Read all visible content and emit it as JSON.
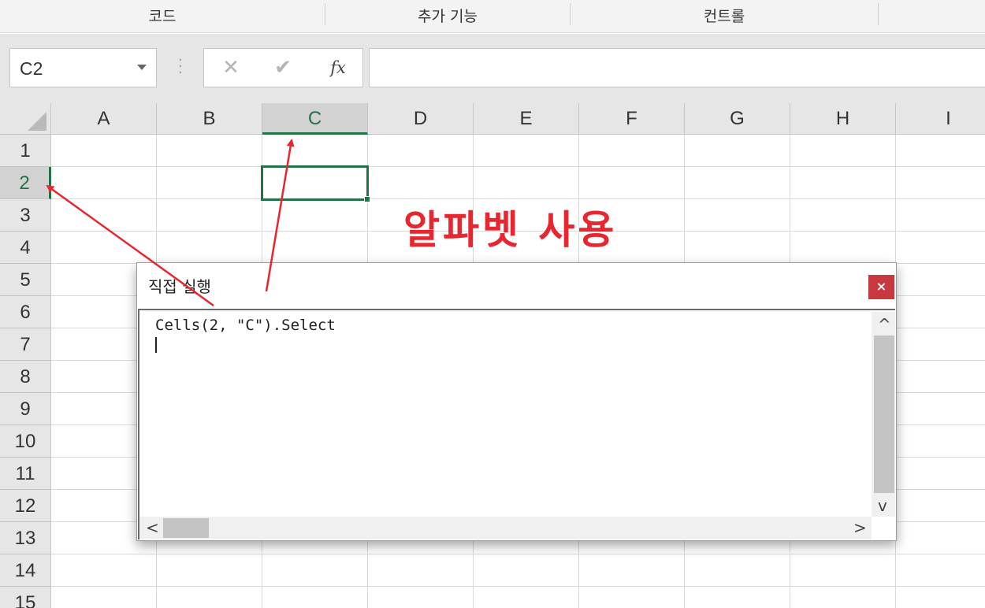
{
  "ribbon": {
    "groups": [
      "코드",
      "추가 기능",
      "컨트롤"
    ]
  },
  "formula_bar": {
    "name_box": "C2",
    "cancel_glyph": "✕",
    "enter_glyph": "✔",
    "fx_label": "fx",
    "formula": ""
  },
  "sheet": {
    "columns": [
      "A",
      "B",
      "C",
      "D",
      "E",
      "F",
      "G",
      "H",
      "I"
    ],
    "rows": [
      "1",
      "2",
      "3",
      "4",
      "5",
      "6",
      "7",
      "8",
      "9",
      "10",
      "11",
      "12",
      "13",
      "14",
      "15"
    ],
    "selected_column": "C",
    "selected_row": "2"
  },
  "annotation": {
    "text": "알파벳 사용",
    "color": "#e8262f"
  },
  "immediate_window": {
    "title": "직접 실행",
    "close_glyph": "×",
    "code_line": "Cells(2, \"C\").Select",
    "scroll_up": "^",
    "scroll_down": "v",
    "scroll_left": "<",
    "scroll_right": ">"
  },
  "colors": {
    "selection_green": "#217346",
    "close_red": "#c8393f",
    "arrow_red": "#e8262f"
  }
}
